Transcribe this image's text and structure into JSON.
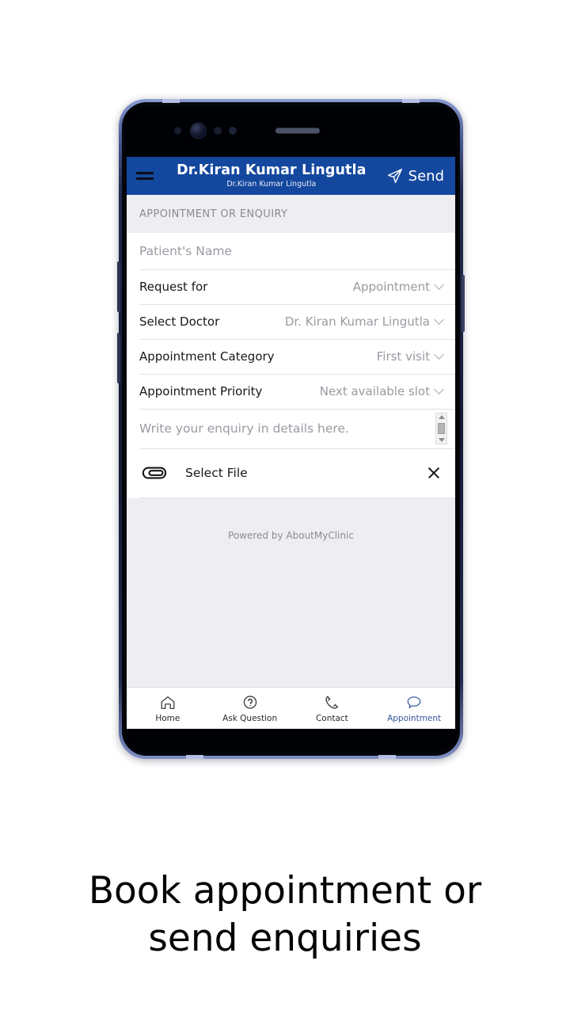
{
  "appbar": {
    "menu_icon": "hamburger-menu-icon",
    "title": "Dr.Kiran Kumar Lingutla",
    "subtitle": "Dr.Kiran Kumar Lingutla",
    "send_icon": "send-paper-plane-icon",
    "send_label": "Send",
    "background_color": "#14489E",
    "title_color": "#FFFFFF"
  },
  "section": {
    "header": "APPOINTMENT OR ENQUIRY"
  },
  "form": {
    "patient_name": {
      "label": "Patient's Name",
      "placeholder": "Patient's Name",
      "value": ""
    },
    "rows": [
      {
        "label": "Request for",
        "value": "Appointment"
      },
      {
        "label": "Select Doctor",
        "value": "Dr. Kiran Kumar Lingutla"
      },
      {
        "label": "Appointment Category",
        "value": "First visit"
      },
      {
        "label": "Appointment Priority",
        "value": "Next available slot"
      }
    ],
    "enquiry": {
      "placeholder": "Write your enquiry in details here.",
      "value": ""
    },
    "file": {
      "icon": "paperclip-icon",
      "label": "Select File",
      "clear_icon": "close-x-icon"
    }
  },
  "footer": {
    "powered_by": "Powered by AboutMyClinic"
  },
  "bottom_nav": {
    "active_color": "#36579C",
    "items": [
      {
        "label": "Home",
        "icon": "home-icon",
        "active": false
      },
      {
        "label": "Ask Question",
        "icon": "question-mark-circle-icon",
        "active": false
      },
      {
        "label": "Contact",
        "icon": "phone-handset-icon",
        "active": false
      },
      {
        "label": "Appointment",
        "icon": "speech-bubble-icon",
        "active": true
      }
    ]
  },
  "caption": {
    "line1": "Book appointment or",
    "line2": "send enquiries"
  }
}
